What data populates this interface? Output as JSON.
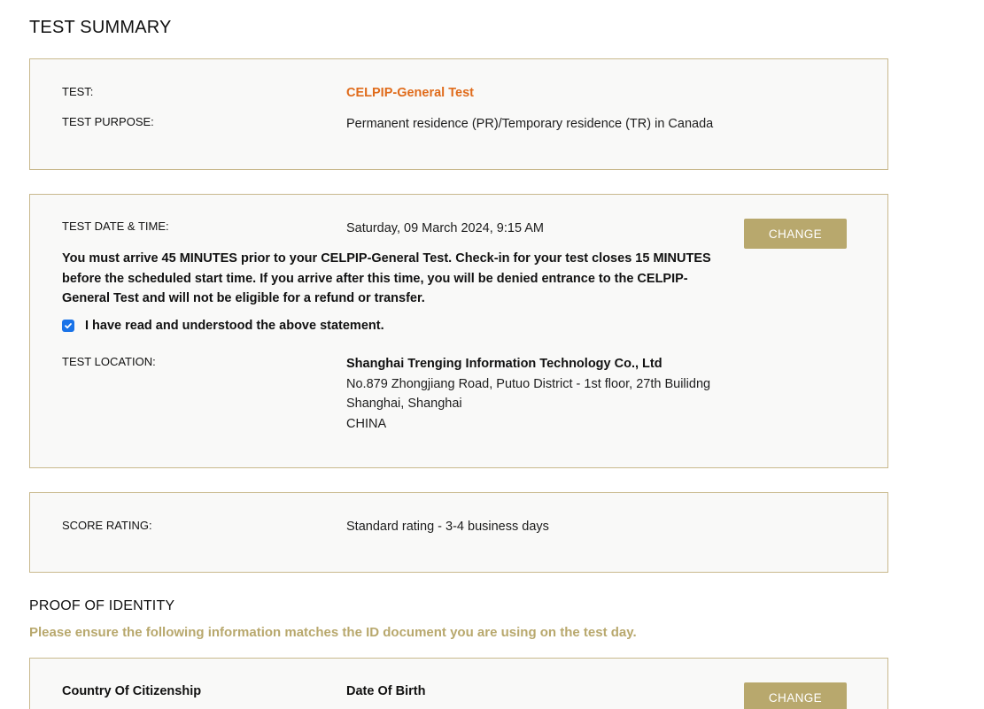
{
  "summary": {
    "title": "TEST SUMMARY"
  },
  "test_info": {
    "test_label": "TEST:",
    "test_value": "CELPIP-General Test",
    "purpose_label": "TEST PURPOSE:",
    "purpose_value": "Permanent residence (PR)/Temporary residence (TR) in Canada"
  },
  "schedule": {
    "datetime_label": "TEST DATE & TIME:",
    "datetime_value": "Saturday, 09 March 2024, 9:15 AM",
    "change_label": "CHANGE",
    "warning": "You must arrive 45 MINUTES prior to your CELPIP-General Test. Check-in for your test closes 15 MINUTES before the scheduled start time. If you arrive after this time, you will be denied entrance to the CELPIP-General Test and will not be eligible for a refund or transfer.",
    "acknowledge_label": "I have read and understood the above statement.",
    "acknowledge_checked": true,
    "location_label": "TEST LOCATION:",
    "location_lines": [
      "Shanghai Trenging Information Technology Co., Ltd",
      "No.879 Zhongjiang Road, Putuo District - 1st floor, 27th Builidng",
      "Shanghai, Shanghai",
      "CHINA"
    ]
  },
  "score": {
    "label": "SCORE RATING:",
    "value": "Standard rating - 3-4 business days"
  },
  "identity": {
    "title": "PROOF OF IDENTITY",
    "notice": "Please ensure the following information matches the ID document you are using on the test day.",
    "citizenship_label": "Country Of Citizenship",
    "dob_label": "Date Of Birth",
    "change_label": "CHANGE"
  },
  "colors": {
    "accent_gold": "#b8a86d",
    "border_gold": "#c9b98d",
    "test_name_orange": "#e06c1c",
    "checkbox_blue": "#1a73e8",
    "panel_bg": "#f9f9f8"
  },
  "icons": {
    "checkbox": "checkmark-icon"
  }
}
